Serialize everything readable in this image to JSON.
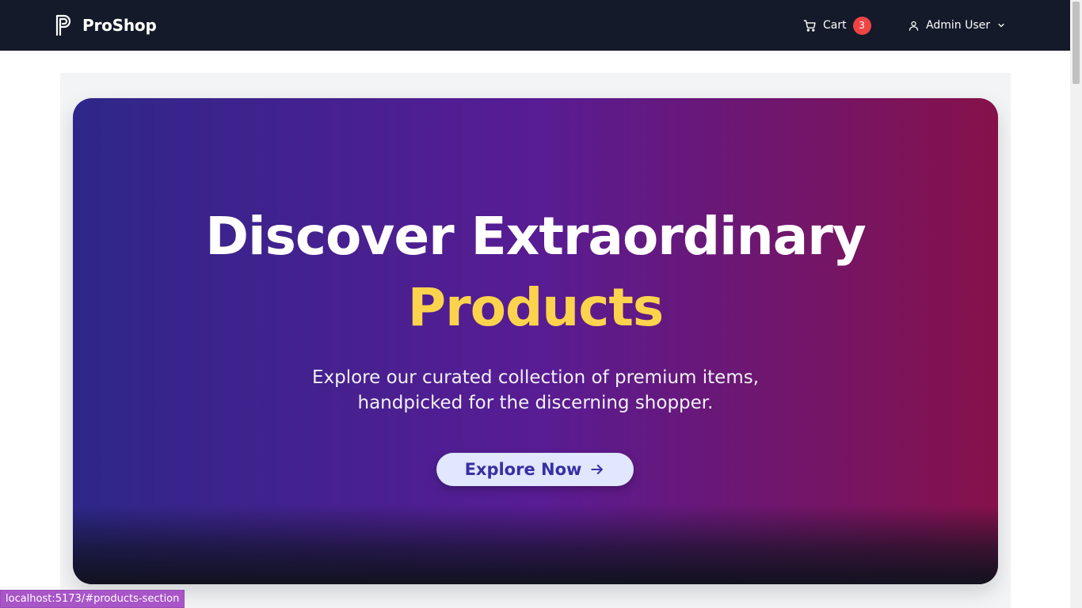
{
  "navbar": {
    "brand_name": "ProShop",
    "logo_icon": "brand-p-icon",
    "cart_label": "Cart",
    "cart_count": "3",
    "cart_icon": "cart-icon",
    "user_label": "Admin User",
    "user_icon": "user-icon",
    "chevron_icon": "chevron-down-icon"
  },
  "hero": {
    "title_line1": "Discover Extraordinary",
    "title_line2": "Products",
    "subtitle": "Explore our curated collection of premium items, handpicked for the discerning shopper.",
    "cta_label": "Explore Now",
    "cta_icon": "arrow-right-icon"
  },
  "status_bar": {
    "url": "localhost:5173/#products-section"
  },
  "colors": {
    "navbar_bg": "#141a29",
    "hero_gradient_start": "#2e2789",
    "hero_gradient_mid": "#581c94",
    "hero_gradient_end": "#86114a",
    "accent_yellow": "#fcd34d",
    "badge_red": "#ef4444",
    "cta_bg": "#e0e7ff",
    "cta_text": "#3730a3"
  }
}
